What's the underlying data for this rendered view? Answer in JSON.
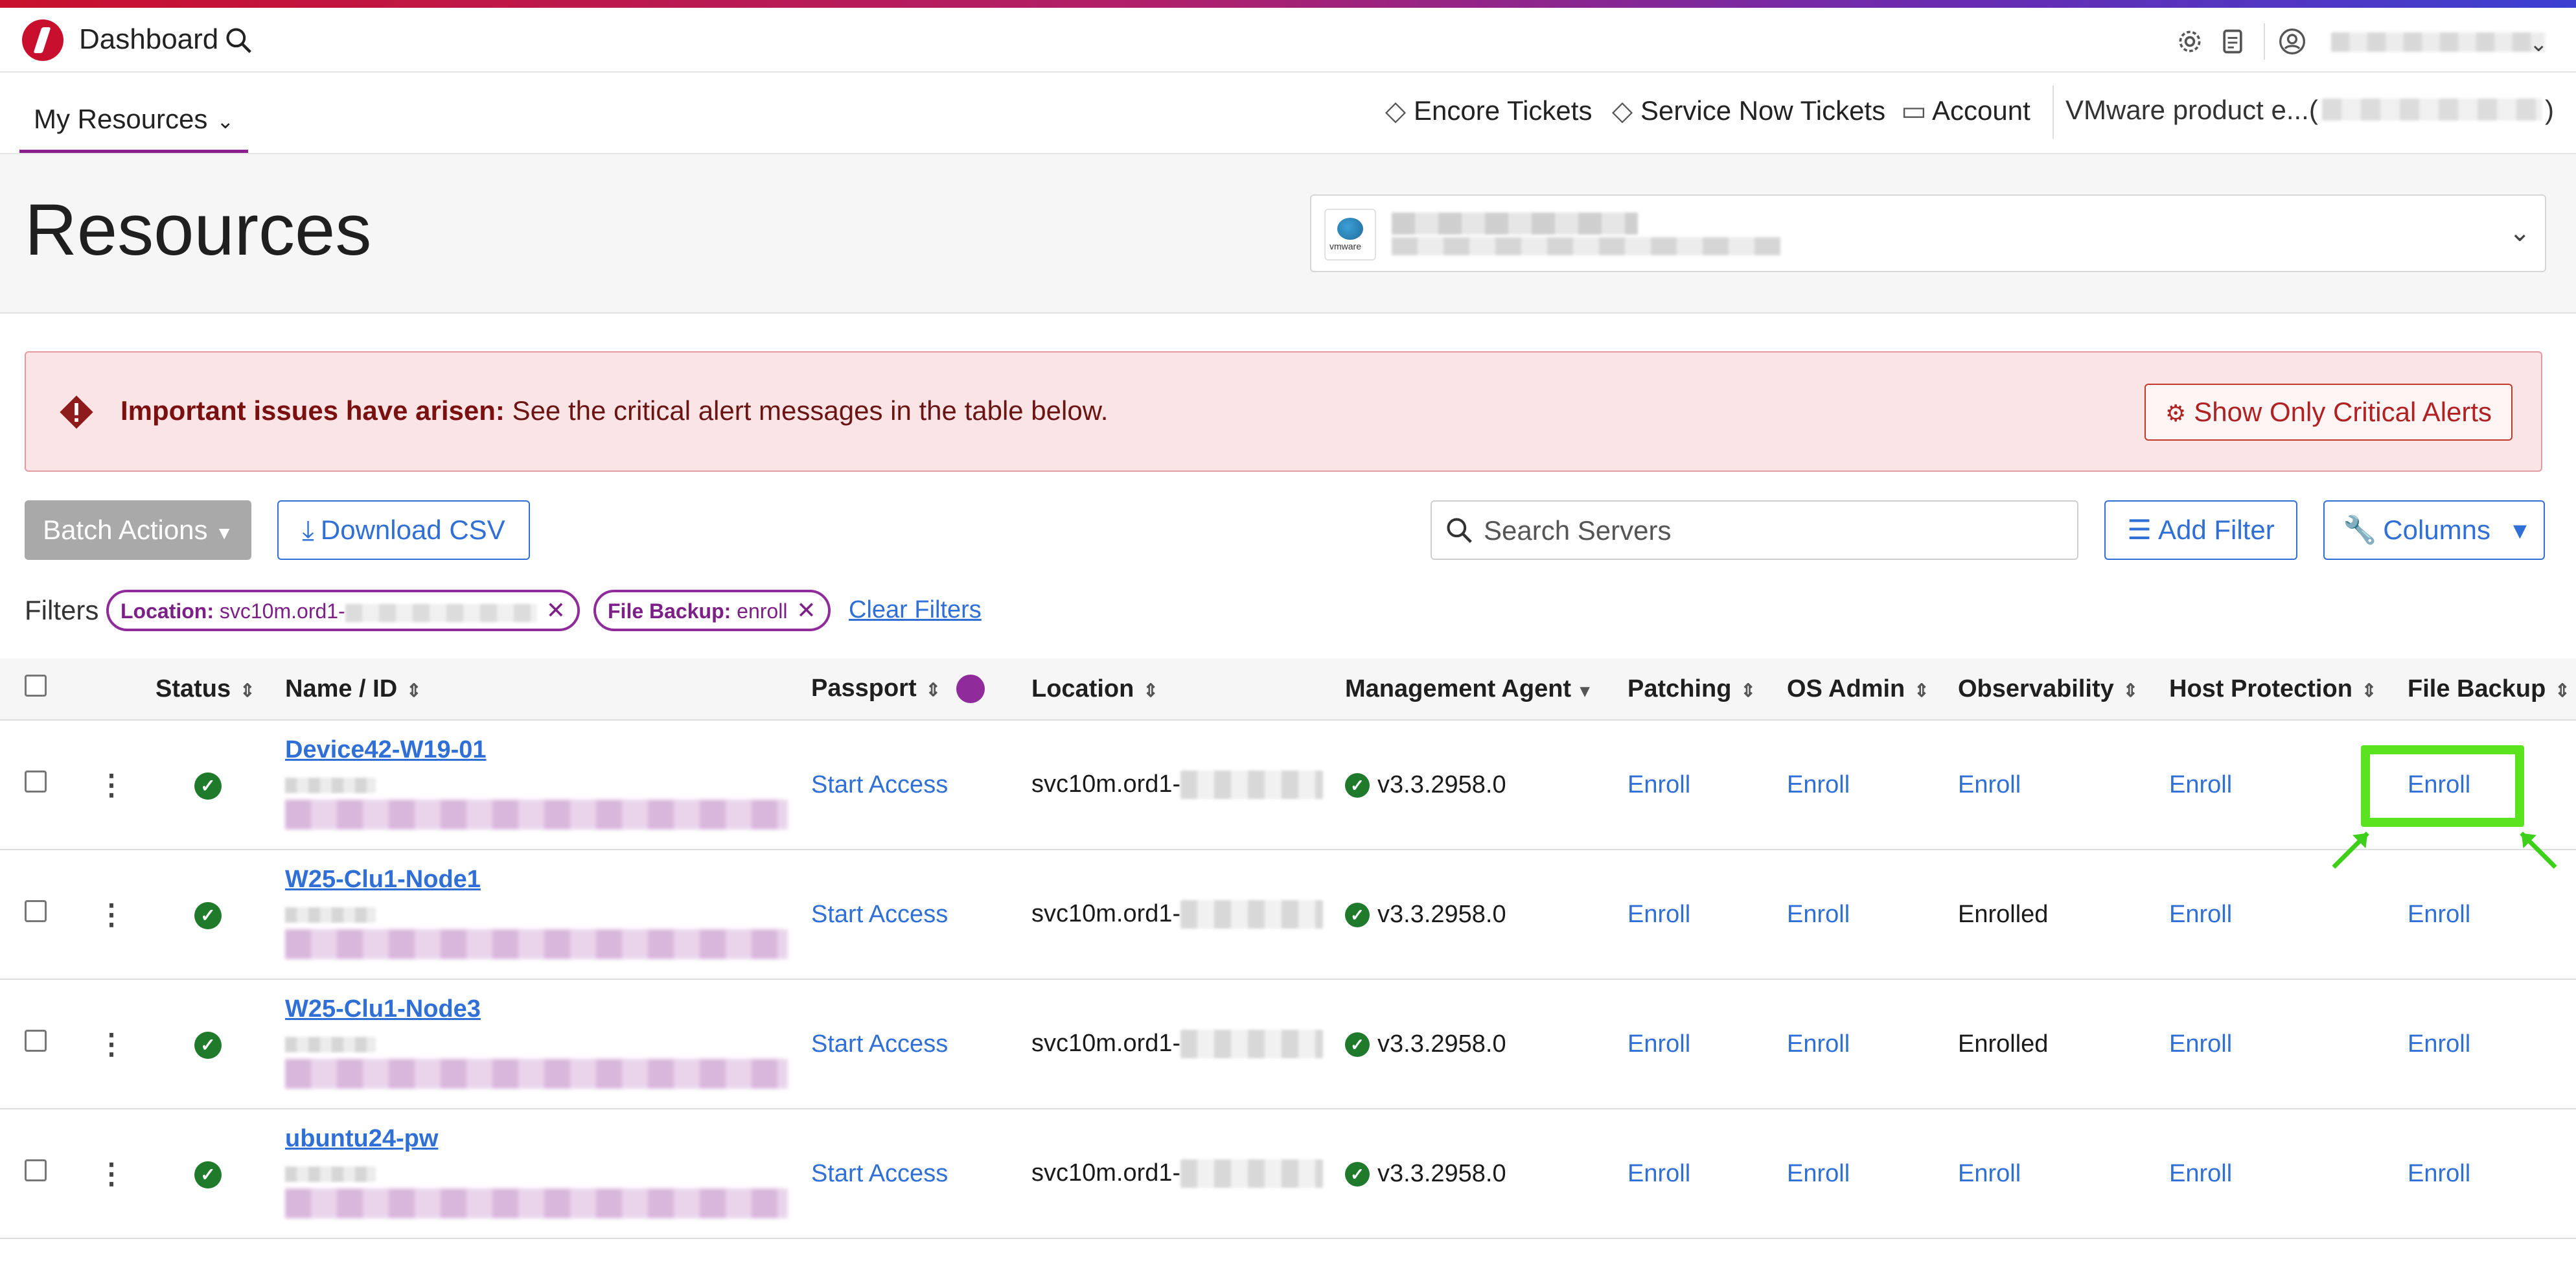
{
  "app": {
    "title": "Dashboard"
  },
  "nav": {
    "my_resources": "My Resources",
    "encore_tickets": "Encore Tickets",
    "servicenow_tickets": "Service Now Tickets",
    "account": "Account",
    "vmware_label": "VMware product e...(",
    "vmware_close": ")"
  },
  "page": {
    "title": "Resources",
    "org_logo_text": "vmware"
  },
  "alert": {
    "strong": "Important issues have arisen:",
    "text": " See the critical alert messages in the table below.",
    "button": "Show Only Critical Alerts"
  },
  "toolbar": {
    "batch_actions": "Batch Actions",
    "download_csv": "Download CSV",
    "search_placeholder": "Search Servers",
    "add_filter": "Add Filter",
    "columns": "Columns"
  },
  "filters": {
    "label": "Filters",
    "chips": [
      {
        "key": "Location:",
        "value": "svc10m.ord1-"
      },
      {
        "key": "File Backup:",
        "value": "enroll"
      }
    ],
    "clear": "Clear Filters"
  },
  "table": {
    "headers": {
      "status": "Status",
      "name": "Name / ID",
      "passport": "Passport",
      "location": "Location",
      "management_agent": "Management Agent",
      "patching": "Patching",
      "os_admin": "OS Admin",
      "observability": "Observability",
      "host_protection": "Host Protection",
      "file_backup": "File Backup"
    },
    "rows": [
      {
        "name": "Device42-W19-01",
        "passport": "Start Access",
        "location": "svc10m.ord1-",
        "agent": "v3.3.2958.0",
        "patching": "Enroll",
        "os_admin": "Enroll",
        "observability": "Enroll",
        "host_protection": "Enroll",
        "file_backup": "Enroll"
      },
      {
        "name": "W25-Clu1-Node1",
        "passport": "Start Access",
        "location": "svc10m.ord1-",
        "agent": "v3.3.2958.0",
        "patching": "Enroll",
        "os_admin": "Enroll",
        "observability": "Enrolled",
        "host_protection": "Enroll",
        "file_backup": "Enroll"
      },
      {
        "name": "W25-Clu1-Node3",
        "passport": "Start Access",
        "location": "svc10m.ord1-",
        "agent": "v3.3.2958.0",
        "patching": "Enroll",
        "os_admin": "Enroll",
        "observability": "Enrolled",
        "host_protection": "Enroll",
        "file_backup": "Enroll"
      },
      {
        "name": "ubuntu24-pw",
        "passport": "Start Access",
        "location": "svc10m.ord1-",
        "agent": "v3.3.2958.0",
        "patching": "Enroll",
        "os_admin": "Enroll",
        "observability": "Enroll",
        "host_protection": "Enroll",
        "file_backup": "Enroll"
      }
    ]
  },
  "colors": {
    "accent_blue": "#2f6fd6",
    "brand_purple": "#8f2b9a",
    "alert_red": "#c0392b",
    "ok_green": "#1f7a2b",
    "highlight_green": "#5ce320"
  }
}
